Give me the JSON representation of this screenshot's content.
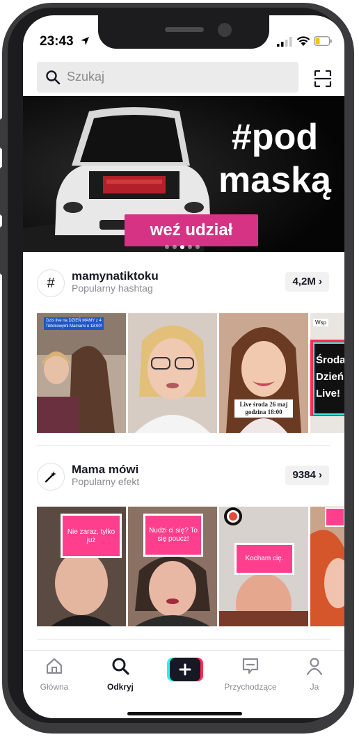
{
  "status": {
    "time": "23:43"
  },
  "search": {
    "placeholder": "Szukaj"
  },
  "banner": {
    "line1": "#pod",
    "line2": "maską",
    "cta": "weź udział"
  },
  "sections": [
    {
      "title": "mamynatiktoku",
      "subtitle": "Popularny hashtag",
      "count": "4,2M",
      "icon": "hashtag-icon",
      "thumbs": [
        {
          "caption": "Dziś live na DZIEŃ MAMY z 4 Tiktokowymi Mamami o 18:00!"
        },
        {
          "caption": ""
        },
        {
          "caption": "Live środa 26 maj godzina 18:00"
        },
        {
          "caption": "Wsp Środa Dzień Live!"
        }
      ]
    },
    {
      "title": "Mama mówi",
      "subtitle": "Popularny efekt",
      "count": "9384",
      "icon": "effect-wand-icon",
      "thumbs": [
        {
          "caption": "Nie zaraz, tylko już"
        },
        {
          "caption": "Nudzi ci się? To się poucz!"
        },
        {
          "caption": "Kocham cię."
        },
        {
          "caption": ""
        }
      ]
    }
  ],
  "tabbar": {
    "items": [
      {
        "label": "Główna",
        "icon": "home-icon"
      },
      {
        "label": "Odkryj",
        "icon": "discover-icon"
      },
      {
        "label": "",
        "icon": "plus-icon"
      },
      {
        "label": "Przychodzące",
        "icon": "inbox-icon"
      },
      {
        "label": "Ja",
        "icon": "profile-icon"
      }
    ]
  },
  "colors": {
    "accent": "#fe2c55",
    "cyan": "#25f4ee",
    "banner_cta": "#d63384"
  }
}
